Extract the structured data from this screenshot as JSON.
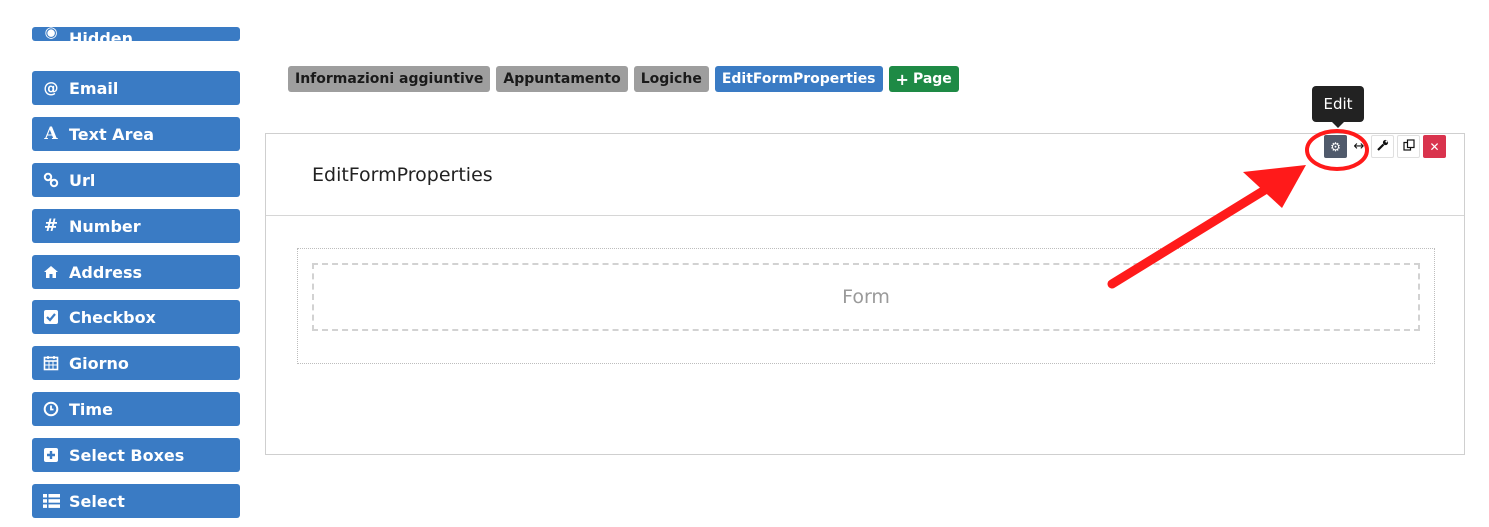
{
  "sidebar": {
    "items": [
      {
        "label": "Hidden",
        "icon": "eye-slash-icon"
      },
      {
        "label": "Email",
        "icon": "at-icon",
        "glyph": "@"
      },
      {
        "label": "Text Area",
        "icon": "font-icon",
        "glyph": "A"
      },
      {
        "label": "Url",
        "icon": "link-icon",
        "glyph": "🔗"
      },
      {
        "label": "Number",
        "icon": "hash-icon",
        "glyph": "#"
      },
      {
        "label": "Address",
        "icon": "home-icon",
        "glyph": "⌂"
      },
      {
        "label": "Checkbox",
        "icon": "check-square-icon",
        "glyph": "☑"
      },
      {
        "label": "Giorno",
        "icon": "calendar-icon",
        "glyph": "▦"
      },
      {
        "label": "Time",
        "icon": "clock-icon",
        "glyph": "◷"
      },
      {
        "label": "Select Boxes",
        "icon": "plus-square-icon",
        "glyph": "⊞"
      },
      {
        "label": "Select",
        "icon": "list-icon",
        "glyph": "☰"
      }
    ]
  },
  "tabs": [
    {
      "label": "Informazioni aggiuntive",
      "style": "grey"
    },
    {
      "label": "Appuntamento",
      "style": "grey"
    },
    {
      "label": "Logiche",
      "style": "grey"
    },
    {
      "label": "EditFormProperties",
      "style": "blue"
    },
    {
      "label": "Page",
      "style": "green",
      "prefix": "+"
    }
  ],
  "panel": {
    "title": "EditFormProperties",
    "dropzone_label": "Form"
  },
  "toolbar": {
    "tooltip": "Edit",
    "buttons": [
      {
        "name": "edit",
        "icon": "gear-icon",
        "glyph": "⚙"
      },
      {
        "name": "move",
        "icon": "move-icon",
        "glyph": "✥"
      },
      {
        "name": "edit-json",
        "icon": "wrench-icon",
        "glyph": "🔧"
      },
      {
        "name": "copy",
        "icon": "copy-icon",
        "glyph": "⧉"
      },
      {
        "name": "remove",
        "icon": "close-icon",
        "glyph": "✕"
      }
    ]
  },
  "colors": {
    "sidebar_button": "#3a7bc4",
    "tab_grey": "#9e9e9e",
    "tab_active": "#3a7bc4",
    "tab_add": "#1e8a45",
    "remove_button": "#d9334d",
    "annotation": "#ff1a1a"
  }
}
